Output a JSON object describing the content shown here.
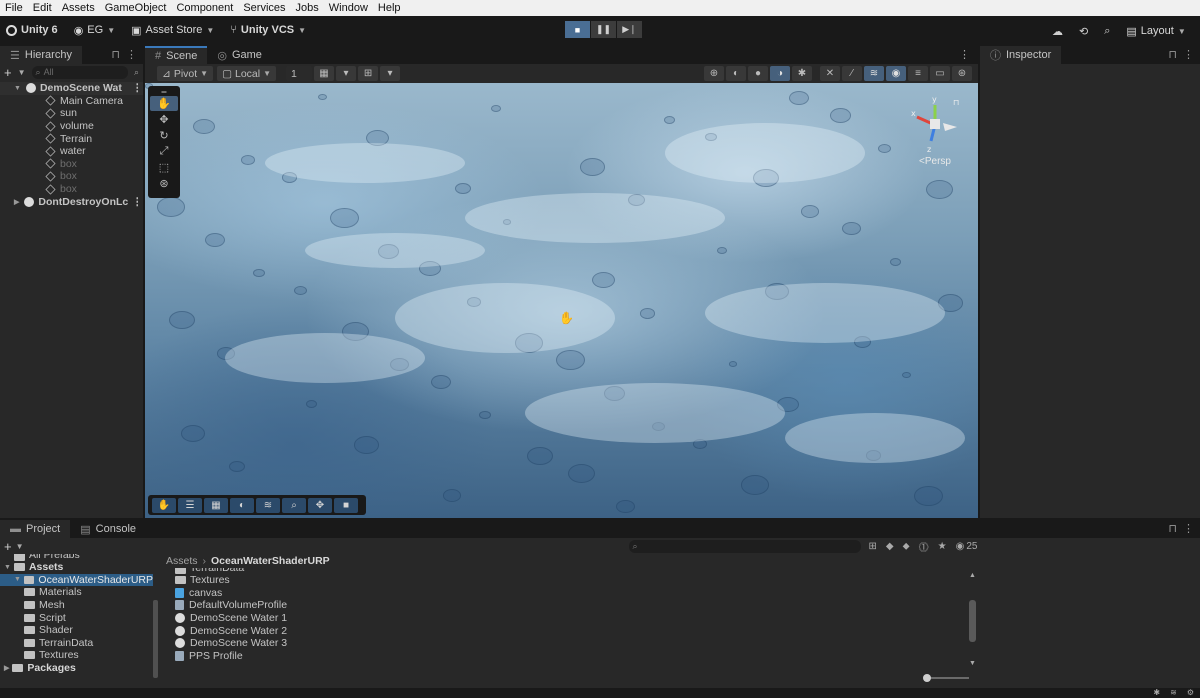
{
  "menu": [
    "File",
    "Edit",
    "Assets",
    "GameObject",
    "Component",
    "Services",
    "Jobs",
    "Window",
    "Help"
  ],
  "toolbar": {
    "app_label": "Unity 6",
    "account": "EG",
    "asset_store": "Asset Store",
    "vcs": "Unity VCS",
    "layout": "Layout",
    "play_icons": [
      "stop-icon",
      "pause-icon",
      "step-icon"
    ]
  },
  "hierarchy": {
    "tab": "Hierarchy",
    "search_placeholder": "All",
    "items": [
      {
        "label": "DemoScene Wat",
        "level": 0,
        "kind": "scene",
        "expanded": true,
        "dim": false
      },
      {
        "label": "Main Camera",
        "level": 1,
        "kind": "object",
        "dim": false
      },
      {
        "label": "sun",
        "level": 1,
        "kind": "object",
        "dim": false
      },
      {
        "label": "volume",
        "level": 1,
        "kind": "object",
        "dim": false
      },
      {
        "label": "Terrain",
        "level": 1,
        "kind": "object",
        "dim": false
      },
      {
        "label": "water",
        "level": 1,
        "kind": "object",
        "dim": false
      },
      {
        "label": "box",
        "level": 1,
        "kind": "object",
        "dim": true
      },
      {
        "label": "box",
        "level": 1,
        "kind": "object",
        "dim": true
      },
      {
        "label": "box",
        "level": 1,
        "kind": "object",
        "dim": true
      },
      {
        "label": "DontDestroyOnLc",
        "level": 0,
        "kind": "scene",
        "expanded": false,
        "dim": false
      }
    ]
  },
  "scene": {
    "tabs": [
      {
        "label": "Scene",
        "active": true
      },
      {
        "label": "Game",
        "active": false
      }
    ],
    "pivot": "Pivot",
    "local": "Local",
    "grid_value": "1",
    "persp_label": "<Persp",
    "gizmo_axes": [
      "y",
      "x",
      "z"
    ]
  },
  "inspector": {
    "tab": "Inspector"
  },
  "project": {
    "tabs": [
      {
        "label": "Project",
        "active": true
      },
      {
        "label": "Console",
        "active": false
      }
    ],
    "search_placeholder": "",
    "item_count": "25",
    "breadcrumb": [
      "Assets",
      "OceanWaterShaderURP"
    ],
    "tree": [
      {
        "label": "All Prefabs",
        "level": 1,
        "partial": true
      },
      {
        "label": "Assets",
        "level": 0,
        "bold": true
      },
      {
        "label": "OceanWaterShaderURP",
        "level": 1,
        "selected": true
      },
      {
        "label": "Materials",
        "level": 2
      },
      {
        "label": "Mesh",
        "level": 2
      },
      {
        "label": "Script",
        "level": 2
      },
      {
        "label": "Shader",
        "level": 2
      },
      {
        "label": "TerrainData",
        "level": 2
      },
      {
        "label": "Textures",
        "level": 2
      },
      {
        "label": "Packages",
        "level": 0,
        "bold": true
      }
    ],
    "files": [
      {
        "label": "TerrainData",
        "kind": "folder",
        "partial": true
      },
      {
        "label": "Textures",
        "kind": "folder"
      },
      {
        "label": "canvas",
        "kind": "prefab"
      },
      {
        "label": "DefaultVolumeProfile",
        "kind": "asset"
      },
      {
        "label": "DemoScene Water 1",
        "kind": "scene"
      },
      {
        "label": "DemoScene Water 2",
        "kind": "scene"
      },
      {
        "label": "DemoScene Water 3",
        "kind": "scene"
      },
      {
        "label": "PPS Profile",
        "kind": "asset"
      }
    ]
  },
  "colors": {
    "accent": "#3a79bb",
    "selection": "#2c5d87",
    "panel": "#282828",
    "background": "#191919"
  }
}
